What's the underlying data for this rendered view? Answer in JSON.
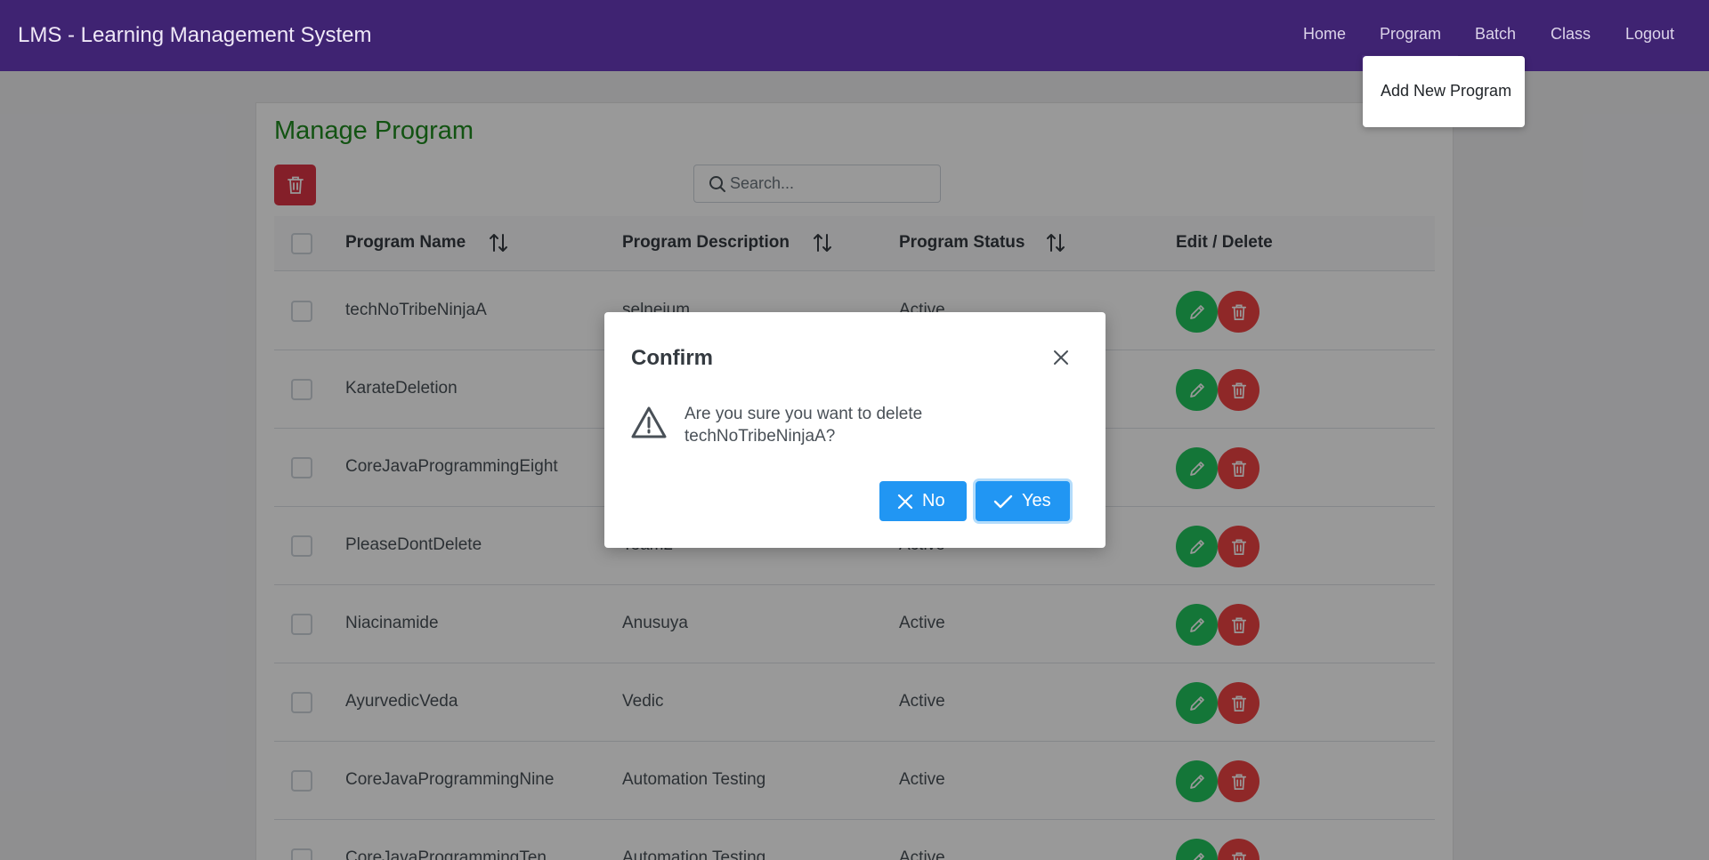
{
  "app": {
    "title": "LMS - Learning Management System"
  },
  "nav": {
    "items": [
      {
        "label": "Home"
      },
      {
        "label": "Program"
      },
      {
        "label": "Batch"
      },
      {
        "label": "Class"
      },
      {
        "label": "Logout"
      }
    ],
    "dropdown": {
      "item": "Add New Program"
    }
  },
  "page": {
    "title": "Manage Program",
    "search": {
      "placeholder": "Search...",
      "value": ""
    }
  },
  "table": {
    "headers": {
      "name": "Program Name",
      "description": "Program Description",
      "status": "Program Status",
      "actions": "Edit / Delete"
    },
    "rows": [
      {
        "name": "techNoTribeNinjaA",
        "description": "selneium",
        "status": "Active"
      },
      {
        "name": "KarateDeletion",
        "description": "",
        "status": ""
      },
      {
        "name": "CoreJavaProgrammingEight",
        "description": "",
        "status": ""
      },
      {
        "name": "PleaseDontDelete",
        "description": "Team2",
        "status": "Active"
      },
      {
        "name": "Niacinamide",
        "description": "Anusuya",
        "status": "Active"
      },
      {
        "name": "AyurvedicVeda",
        "description": "Vedic",
        "status": "Active"
      },
      {
        "name": "CoreJavaProgrammingNine",
        "description": "Automation Testing",
        "status": "Active"
      },
      {
        "name": "CoreJavaProgrammingTen",
        "description": "Automation Testing",
        "status": "Active"
      }
    ]
  },
  "dialog": {
    "title": "Confirm",
    "message": "Are you sure you want to delete techNoTribeNinjaA?",
    "no_label": "No",
    "yes_label": "Yes"
  },
  "colors": {
    "topbar": "#3f2372",
    "title_green": "#1e8a1e",
    "edit_button": "#22c55e",
    "delete_button": "#ef4444",
    "primary": "#2196f3"
  },
  "icons": {
    "bulk_delete": "trash-icon",
    "search": "search-icon",
    "sort": "sort-icon",
    "edit": "pencil-icon",
    "delete": "trash-icon",
    "close": "close-icon",
    "warning": "warning-icon",
    "no": "close-icon",
    "yes": "check-icon"
  }
}
